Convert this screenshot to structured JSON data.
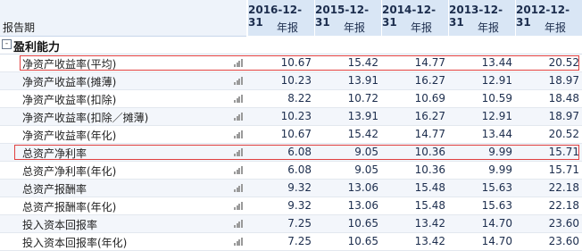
{
  "header": {
    "label": "报告期",
    "periods": [
      {
        "date": "2016-12-31",
        "type": "年报"
      },
      {
        "date": "2015-12-31",
        "type": "年报"
      },
      {
        "date": "2014-12-31",
        "type": "年报"
      },
      {
        "date": "2013-12-31",
        "type": "年报"
      },
      {
        "date": "2012-12-31",
        "type": "年报"
      }
    ]
  },
  "section": {
    "label": "盈利能力",
    "toggle": "-"
  },
  "rows": [
    {
      "name": "净资产收益率(平均)",
      "values": [
        "10.67",
        "15.42",
        "14.77",
        "13.44",
        "20.52"
      ],
      "highlight": true
    },
    {
      "name": "净资产收益率(摊薄)",
      "values": [
        "10.23",
        "13.91",
        "16.27",
        "12.91",
        "18.97"
      ]
    },
    {
      "name": "净资产收益率(扣除)",
      "values": [
        "8.22",
        "10.72",
        "10.69",
        "10.59",
        "18.48"
      ]
    },
    {
      "name": "净资产收益率(扣除／摊薄)",
      "values": [
        "10.23",
        "13.91",
        "16.27",
        "12.91",
        "18.97"
      ]
    },
    {
      "name": "净资产收益率(年化)",
      "values": [
        "10.67",
        "15.42",
        "14.77",
        "13.44",
        "20.52"
      ]
    },
    {
      "name": "总资产净利率",
      "values": [
        "6.08",
        "9.05",
        "10.36",
        "9.99",
        "15.71"
      ],
      "highlight": true
    },
    {
      "name": "总资产净利率(年化)",
      "values": [
        "6.08",
        "9.05",
        "10.36",
        "9.99",
        "15.71"
      ]
    },
    {
      "name": "总资产报酬率",
      "values": [
        "9.32",
        "13.06",
        "15.48",
        "15.63",
        "22.18"
      ]
    },
    {
      "name": "总资产报酬率(年化)",
      "values": [
        "9.32",
        "13.06",
        "15.48",
        "15.63",
        "22.18"
      ]
    },
    {
      "name": "投入资本回报率",
      "values": [
        "7.25",
        "10.65",
        "13.42",
        "14.70",
        "23.60"
      ]
    },
    {
      "name": "投入资本回报率(年化)",
      "values": [
        "7.25",
        "10.65",
        "13.42",
        "14.70",
        "23.60"
      ]
    }
  ]
}
